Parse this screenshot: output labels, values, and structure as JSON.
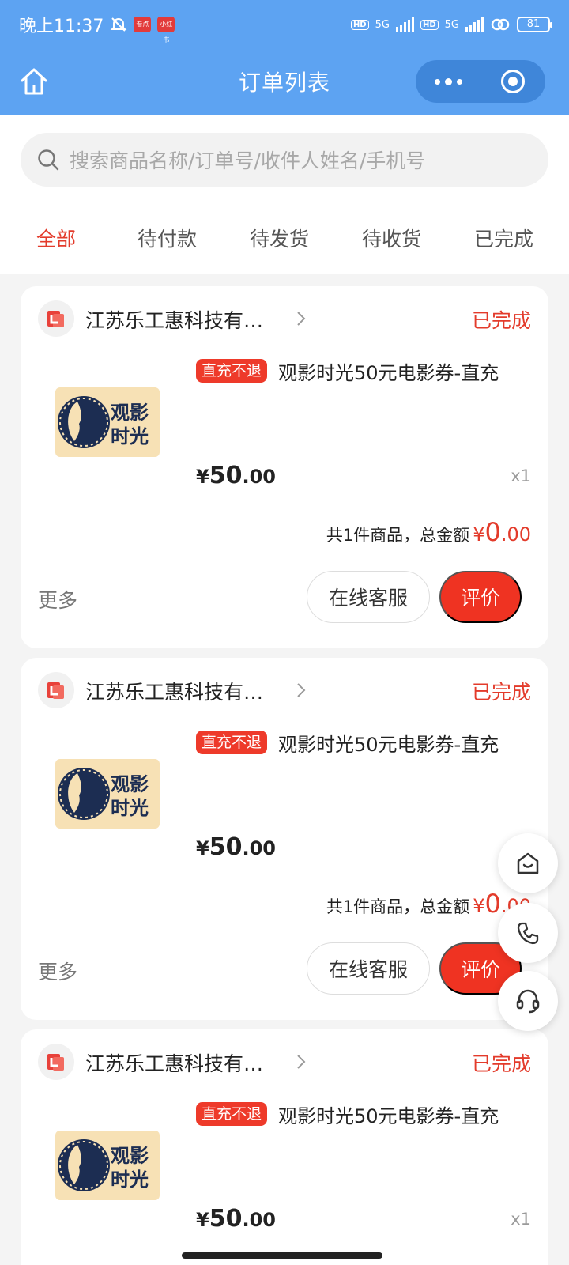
{
  "status_bar": {
    "time": "晚上11:37",
    "badge1": "看点",
    "badge2": "小红书",
    "hd": "HD",
    "net": "5G",
    "battery": "81"
  },
  "nav": {
    "title": "订单列表"
  },
  "search": {
    "placeholder": "搜索商品名称/订单号/收件人姓名/手机号"
  },
  "tabs": [
    "全部",
    "待付款",
    "待发货",
    "待收货",
    "已完成"
  ],
  "orders": [
    {
      "store": "江苏乐工惠科技有限公司",
      "status": "已完成",
      "tag": "直充不退",
      "product": "观影时光50元电影券-直充",
      "thumb_text": [
        "观影",
        "时光"
      ],
      "price_sym": "¥",
      "price_int": "50",
      "price_dec": ".00",
      "qty": "x1",
      "summary_label": "共1件商品，总金额",
      "total_sym": "¥",
      "total_int": "0",
      "total_dec": ".00",
      "more": "更多",
      "service_btn": "在线客服",
      "review_btn": "评价"
    },
    {
      "store": "江苏乐工惠科技有限公司",
      "status": "已完成",
      "tag": "直充不退",
      "product": "观影时光50元电影券-直充",
      "thumb_text": [
        "观影",
        "时光"
      ],
      "price_sym": "¥",
      "price_int": "50",
      "price_dec": ".00",
      "qty": "x1",
      "summary_label": "共1件商品，总金额",
      "total_sym": "¥",
      "total_int": "0",
      "total_dec": ".00",
      "more": "更多",
      "service_btn": "在线客服",
      "review_btn": "评价"
    },
    {
      "store": "江苏乐工惠科技有限公司",
      "status": "已完成",
      "tag": "直充不退",
      "product": "观影时光50元电影券-直充",
      "thumb_text": [
        "观影",
        "时光"
      ],
      "price_sym": "¥",
      "price_int": "50",
      "price_dec": ".00",
      "qty": "x1"
    }
  ],
  "colors": {
    "header": "#5da3f2",
    "accent_red": "#ef3322",
    "status_red": "#e33b2b",
    "thumb_bg": "#f7e1b5",
    "thumb_navy": "#1c2d52"
  },
  "icons": {
    "home": "home-icon",
    "search": "search-icon",
    "chevron": "chevron-right-icon",
    "float": [
      "shop-icon",
      "phone-icon",
      "headset-icon"
    ]
  }
}
